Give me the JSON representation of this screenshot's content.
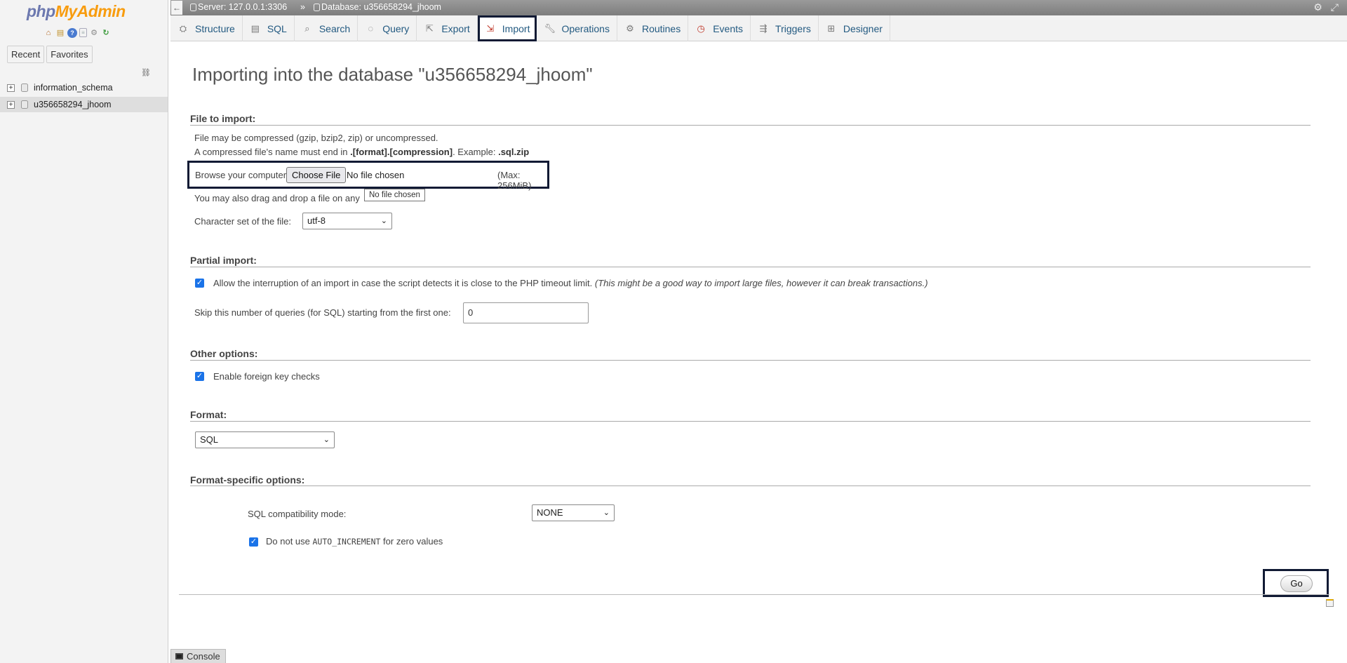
{
  "app": {
    "logo_php": "php",
    "logo_my": "MyAdmin"
  },
  "nav": {
    "icons": [
      "home-icon",
      "database-icon",
      "help-icon",
      "documentation-icon",
      "settings-icon",
      "reload-icon"
    ],
    "recent_label": "Recent",
    "favorites_label": "Favorites",
    "databases": [
      {
        "name": "information_schema",
        "expander": "+"
      },
      {
        "name": "u356658294_jhoom",
        "expander": "+"
      }
    ]
  },
  "breadcrumb": {
    "server": "Server: 127.0.0.1:3306",
    "separator": "»",
    "database": "Database: u356658294_jhoom"
  },
  "menu": {
    "tabs": [
      {
        "label": "Structure",
        "icon": "structure-icon"
      },
      {
        "label": "SQL",
        "icon": "sql-icon"
      },
      {
        "label": "Search",
        "icon": "search-icon"
      },
      {
        "label": "Query",
        "icon": "query-icon"
      },
      {
        "label": "Export",
        "icon": "export-icon"
      },
      {
        "label": "Import",
        "icon": "import-icon",
        "active": true
      },
      {
        "label": "Operations",
        "icon": "wrench-icon"
      },
      {
        "label": "Routines",
        "icon": "routines-icon"
      },
      {
        "label": "Events",
        "icon": "clock-icon"
      },
      {
        "label": "Triggers",
        "icon": "triggers-icon"
      },
      {
        "label": "Designer",
        "icon": "designer-icon"
      }
    ]
  },
  "page": {
    "title": "Importing into the database \"u356658294_jhoom\""
  },
  "file_import": {
    "legend": "File to import:",
    "line1": "File may be compressed (gzip, bzip2, zip) or uncompressed.",
    "line2_prefix": "A compressed file's name must end in ",
    "line2_format": ".[format].[compression]",
    "line2_mid": ". Example: ",
    "line2_example": ".sql.zip",
    "browse_label": "Browse your computer:",
    "choose_file_button": "Choose File",
    "no_file_text": "No file chosen",
    "max_size": "(Max: 256MiB)",
    "drag_text": "You may also drag and drop a file on any",
    "tooltip": "No file chosen",
    "charset_label": "Character set of the file:",
    "charset_value": "utf-8"
  },
  "partial_import": {
    "legend": "Partial import:",
    "allow_interrupt_label": "Allow the interruption of an import in case the script detects it is close to the PHP timeout limit.",
    "allow_interrupt_note": "(This might be a good way to import large files, however it can break transactions.)",
    "allow_interrupt_checked": true,
    "skip_label": "Skip this number of queries (for SQL) starting from the first one:",
    "skip_value": "0"
  },
  "other_options": {
    "legend": "Other options:",
    "foreign_key_label": "Enable foreign key checks",
    "foreign_key_checked": true
  },
  "format": {
    "legend": "Format:",
    "value": "SQL"
  },
  "format_specific": {
    "legend": "Format-specific options:",
    "compat_label": "SQL compatibility mode:",
    "compat_value": "NONE",
    "auto_inc_prefix": "Do not use ",
    "auto_inc_code": "AUTO_INCREMENT",
    "auto_inc_suffix": " for zero values",
    "auto_inc_checked": true
  },
  "actions": {
    "go_label": "Go"
  },
  "console": {
    "label": "Console"
  }
}
